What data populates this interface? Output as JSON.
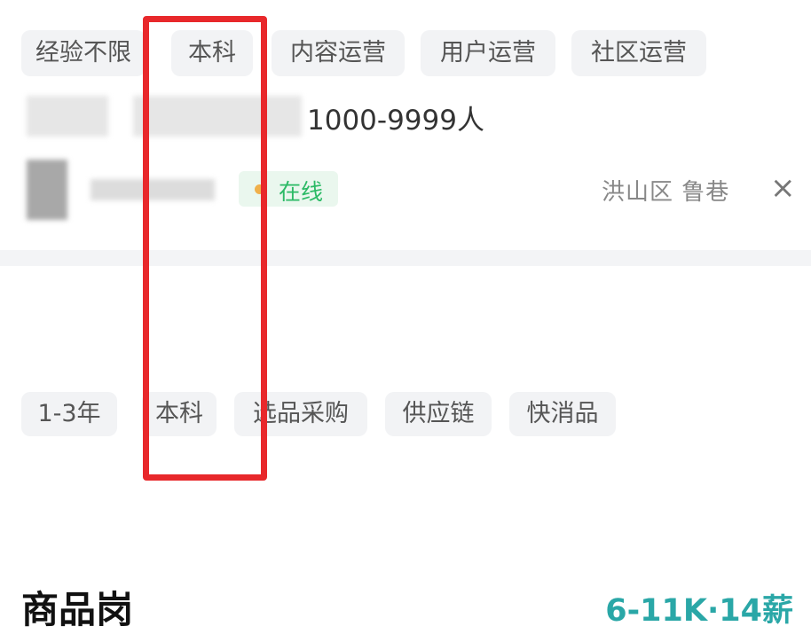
{
  "job1": {
    "tags": [
      "经验不限",
      "本科",
      "内容运营",
      "用户运营",
      "社区运营"
    ],
    "company_size": "1000-9999人",
    "online_status": "在线",
    "location": "洪山区 鲁巷",
    "close_icon": "×"
  },
  "job2": {
    "title": "商品岗",
    "salary": "6-11K·14薪",
    "tags": [
      "1-3年",
      "本科",
      "选品采购",
      "供应链",
      "快消品"
    ]
  },
  "colors": {
    "salary": "#2aa7a7",
    "online_text": "#2cba66",
    "online_bg": "#eaf7ee",
    "online_dot": "#f0b04a",
    "highlight_box": "#e8282b"
  }
}
